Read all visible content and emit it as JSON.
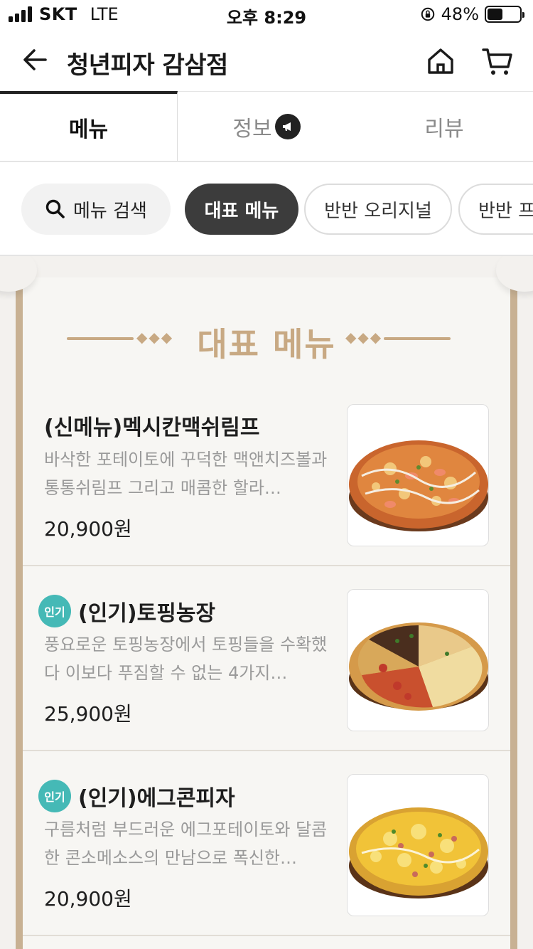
{
  "status_bar": {
    "carrier": "SKT",
    "network": "LTE",
    "time": "오후 8:29",
    "battery_percent": "48%",
    "battery_level": 0.48
  },
  "header": {
    "title": "청년피자 감삼점"
  },
  "tabs": [
    {
      "label": "메뉴",
      "active": true
    },
    {
      "label": "정보",
      "active": false
    },
    {
      "label": "리뷰",
      "active": false
    }
  ],
  "chips": {
    "search_label": "메뉴 검색",
    "items": [
      "대표 메뉴",
      "반반 오리지널",
      "반반 프"
    ]
  },
  "section": {
    "title": "대표 메뉴"
  },
  "menu_items": [
    {
      "badge": "",
      "name": "(신메뉴)멕시칸맥쉬림프",
      "description": "바삭한 포테이토에 꾸덕한 맥앤치즈볼과 통통쉬림프 그리고 매콤한 할라…",
      "price": "20,900원"
    },
    {
      "badge": "인기",
      "name": "(인기)토핑농장",
      "description": "풍요로운 토핑농장에서 토핑들을 수확했다 이보다 푸짐할 수 없는 4가지…",
      "price": "25,900원"
    },
    {
      "badge": "인기",
      "name": "(인기)에그콘피자",
      "description": "구름처럼 부드러운 에그포테이토와 달콤한 콘소메소스의 만남으로 폭신한…",
      "price": "20,900원"
    }
  ],
  "colors": {
    "accent_gold": "#c8a983",
    "badge_teal": "#45b9b6",
    "active_chip": "#3c3c3c"
  }
}
